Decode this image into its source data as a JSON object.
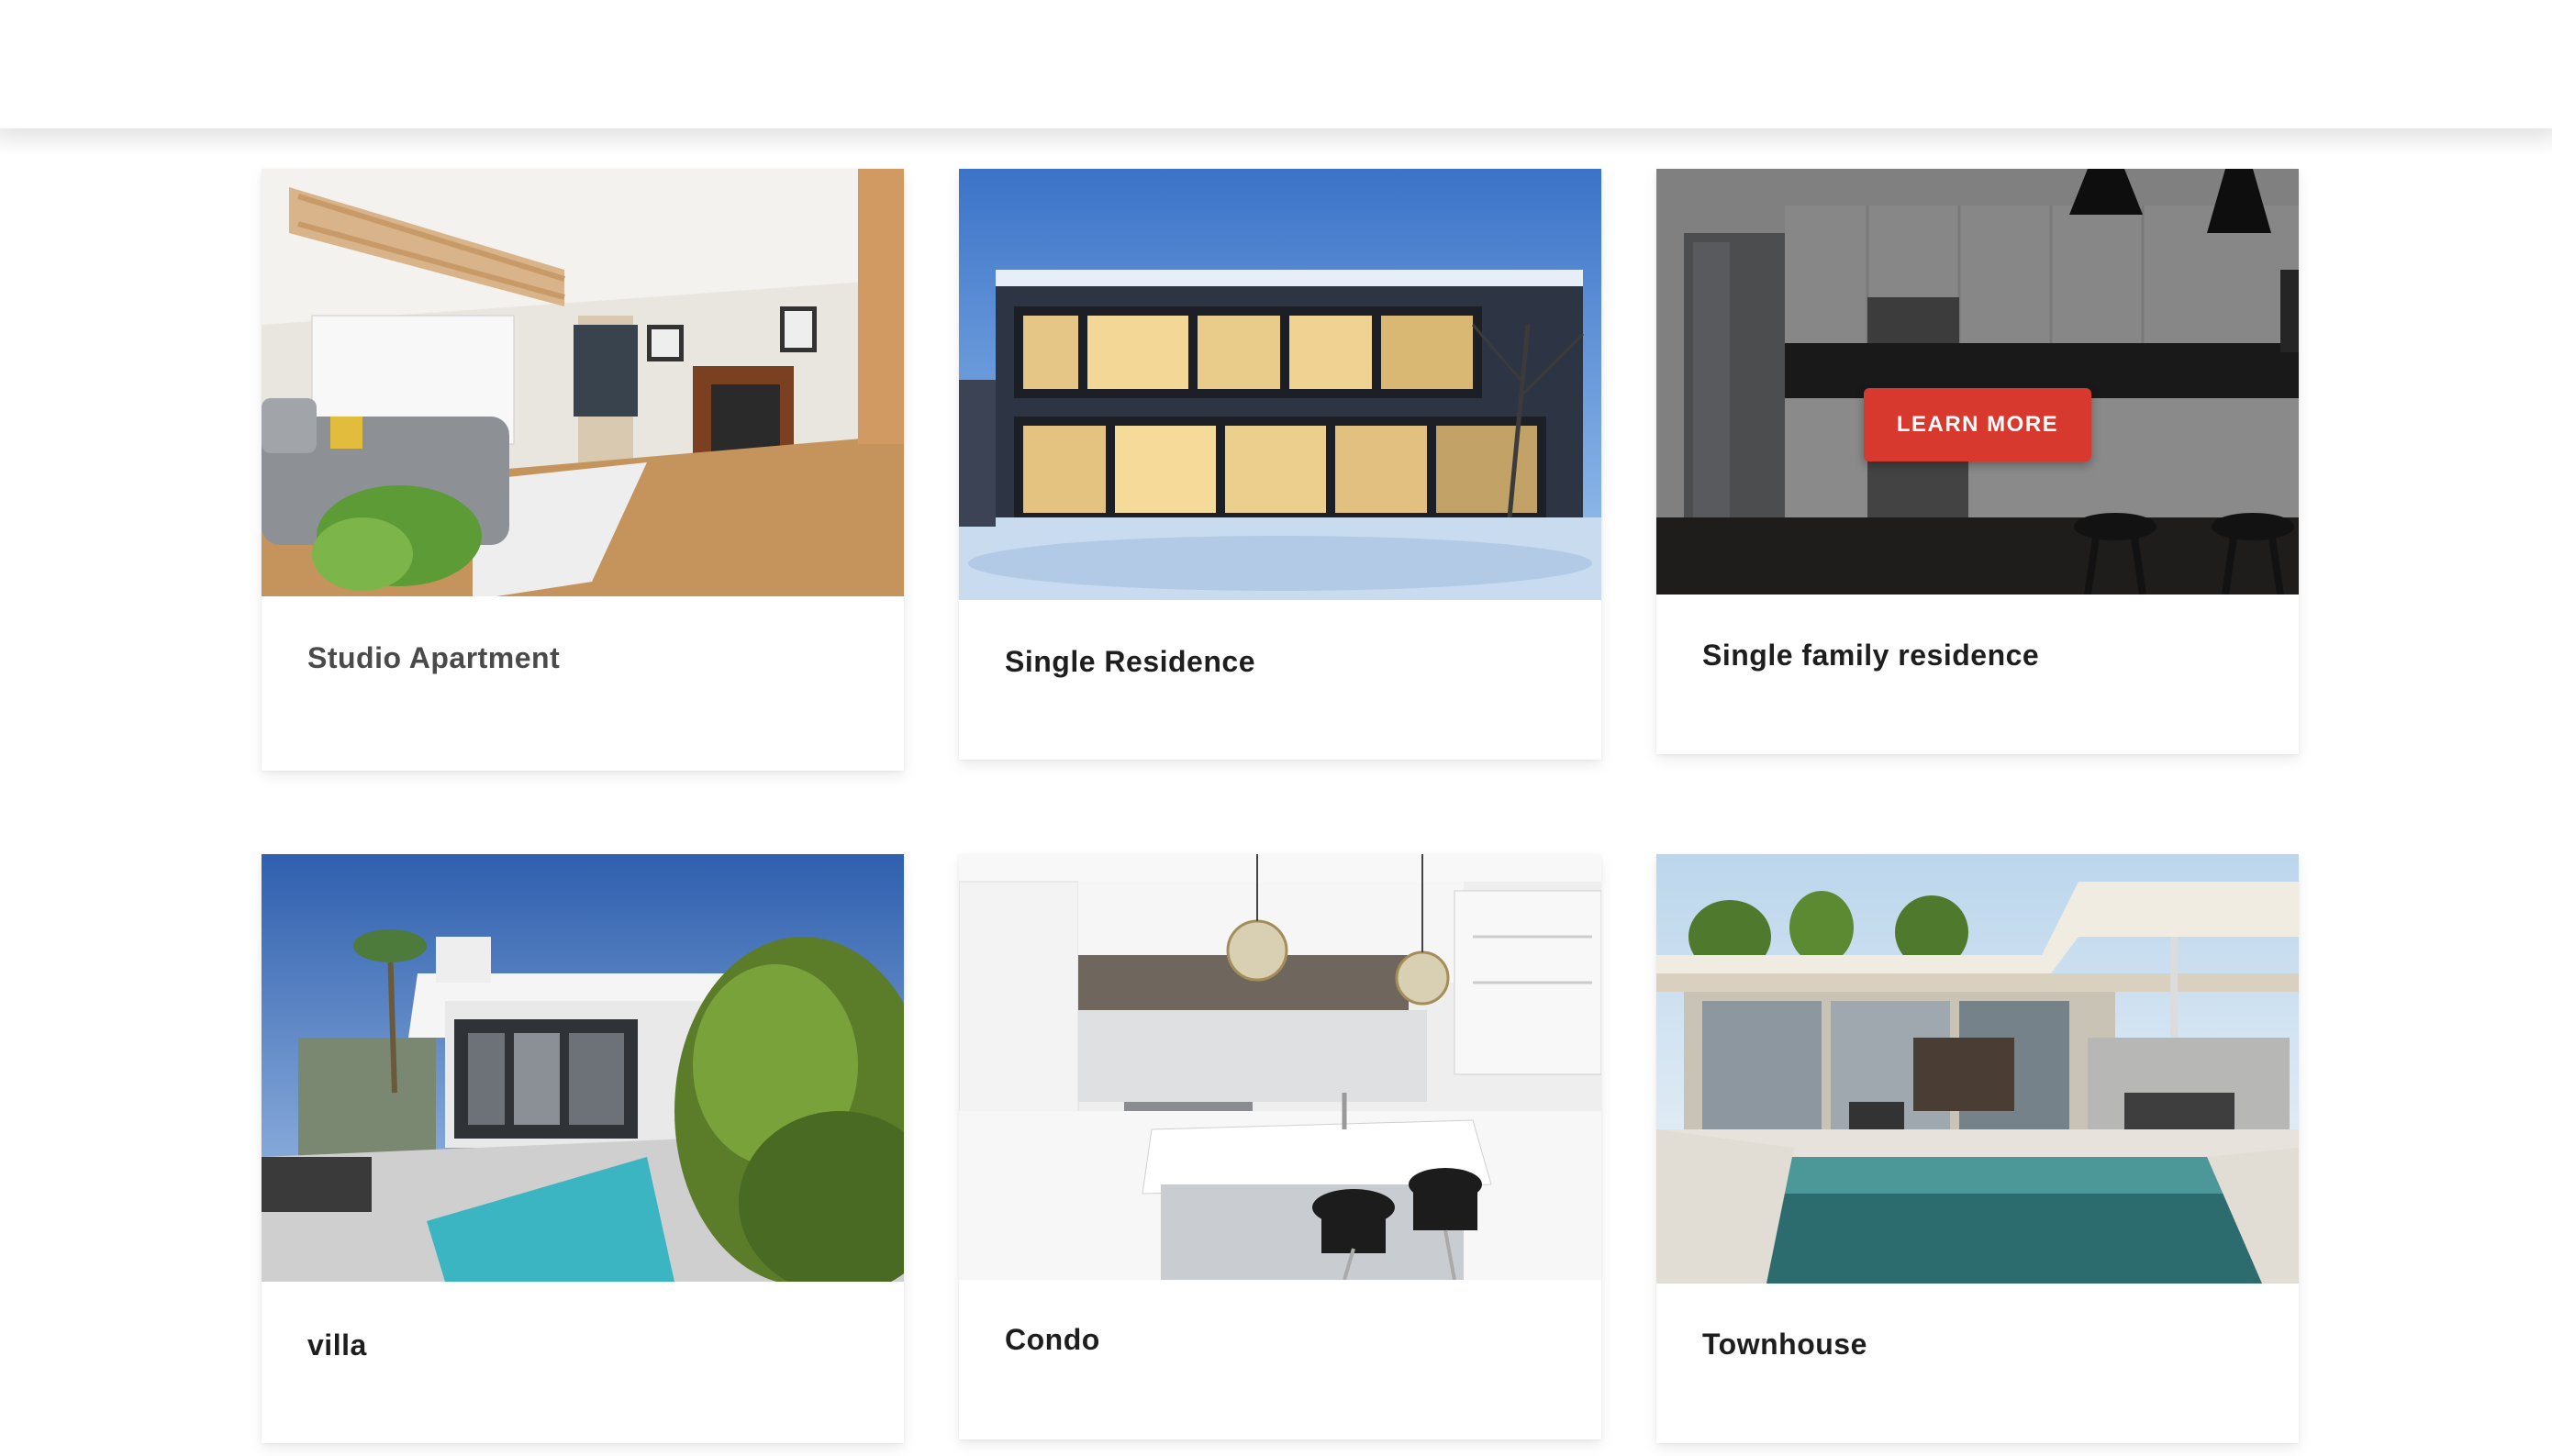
{
  "cards": [
    {
      "title": "Studio Apartment"
    },
    {
      "title": "Single Residence"
    },
    {
      "title": "Single family residence",
      "hover_button": "LEARN MORE"
    },
    {
      "title": "villa"
    },
    {
      "title": "Condo"
    },
    {
      "title": "Townhouse"
    }
  ],
  "colors": {
    "accent_button": "#d8392f",
    "title_text": "#1e1e1e"
  }
}
